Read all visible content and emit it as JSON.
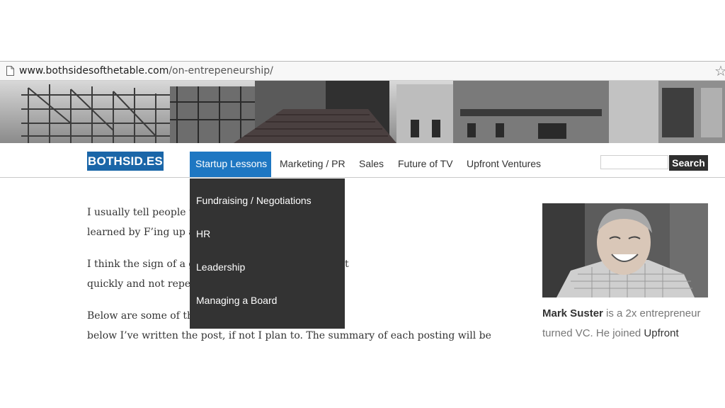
{
  "browser": {
    "url_domain": "www.bothsidesofthetable.com",
    "url_path": "/on-entrepeneurship/",
    "page_icon": "page-icon",
    "bookmark_icon": "star-icon"
  },
  "nav": {
    "logo": "BOTHSID.ES",
    "items": [
      {
        "label": "Startup Lessons"
      },
      {
        "label": "Marketing / PR"
      },
      {
        "label": "Sales"
      },
      {
        "label": "Future of TV"
      },
      {
        "label": "Upfront Ventures"
      }
    ],
    "search_button": "Search",
    "search_value": ""
  },
  "dropdown": {
    "items": [
      {
        "label": "Fundraising / Negotiations"
      },
      {
        "label": "HR"
      },
      {
        "label": "Leadership"
      },
      {
        "label": "Managing a Board"
      }
    ]
  },
  "article": {
    "lines": [
      "I usually tell people t                                          being an entrepreneur I",
      "learned by F’ing up a",
      "I think the sign of a g                                          to spot your mistakes, correct",
      "quickly and not repe                                              f mistakes.",
      "Below are some of th                                            ay.  If there’s a link on a title",
      "below I’ve written the post, if not I plan to.  The summary of each posting will be"
    ]
  },
  "sidebar": {
    "bio_name": "Mark Suster",
    "bio_text_1": " is a 2x entrepreneur",
    "bio_text_2": "turned VC. He joined ",
    "bio_link": "Upfront"
  },
  "colors": {
    "brand_blue": "#1a66a8",
    "active_tab": "#1e77c2",
    "dropdown_bg": "#333333"
  }
}
